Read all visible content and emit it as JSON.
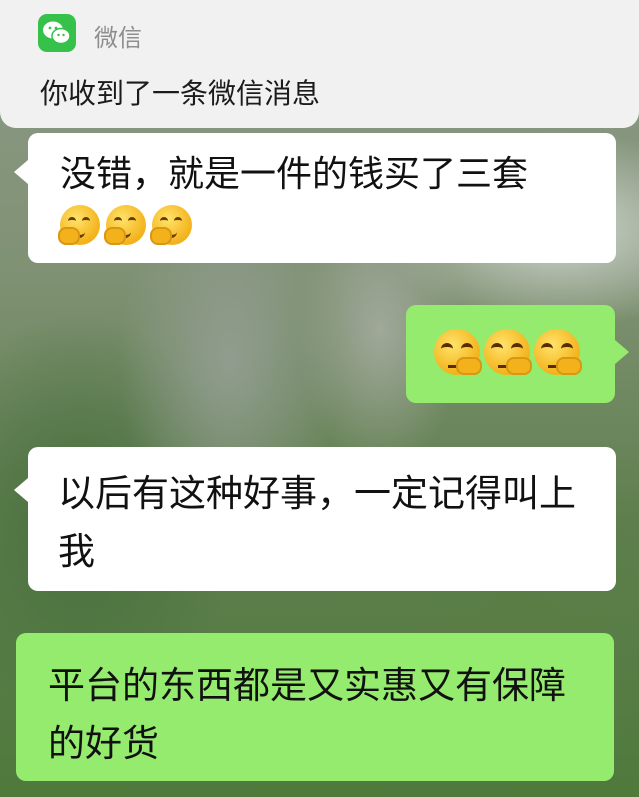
{
  "notification": {
    "app_name": "微信",
    "app_icon": "wechat-icon",
    "message_preview": "你收到了一条微信消息"
  },
  "messages": [
    {
      "side": "left",
      "color": "white",
      "text": "没错，就是一件的钱买了三套",
      "emojis": [
        "thinking-hand-face",
        "thinking-hand-face",
        "thinking-hand-face"
      ]
    },
    {
      "side": "right",
      "color": "green",
      "text": "",
      "emojis": [
        "smirk-thinking-face",
        "smirk-thinking-face",
        "smirk-thinking-face"
      ]
    },
    {
      "side": "left",
      "color": "white",
      "text": "以后有这种好事，一定记得叫上我"
    },
    {
      "side": "left",
      "color": "green",
      "text": "平台的东西都是又实惠又有保障的好货"
    }
  ],
  "colors": {
    "bubble_white": "#ffffff",
    "bubble_green": "#95eb6e",
    "wechat_green": "#35c14a"
  }
}
